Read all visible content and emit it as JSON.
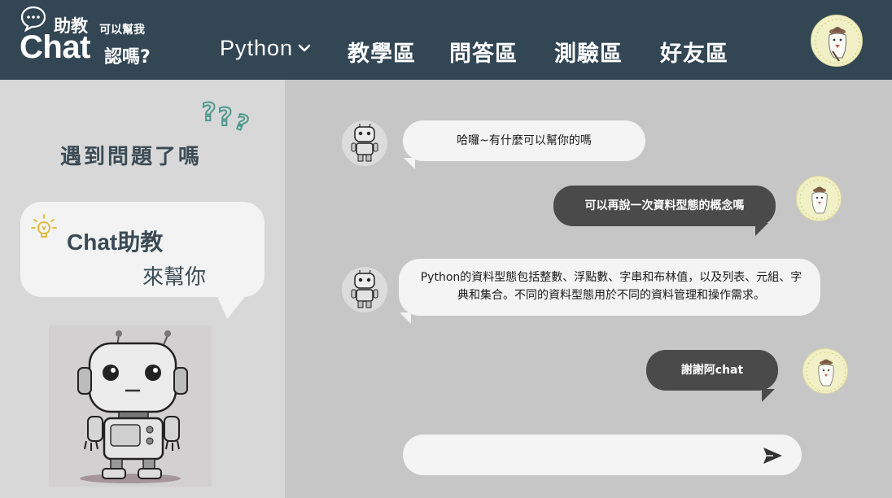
{
  "app": {
    "logo_line1": "助教",
    "logo_line2": "可以幫我",
    "logo_line3": "Chat",
    "logo_line4": "認嗎?"
  },
  "nav": {
    "items": [
      {
        "label": "Python"
      },
      {
        "label": "教學區"
      },
      {
        "label": "問答區"
      },
      {
        "label": "測驗區"
      },
      {
        "label": "好友區"
      }
    ]
  },
  "sidebar": {
    "title": "遇到問題了嗎",
    "speech_line1": "Chat助教",
    "speech_line2": "來幫你"
  },
  "chat": {
    "messages": [
      {
        "from": "bot",
        "text": "哈囉~有什麼可以幫你的嗎"
      },
      {
        "from": "user",
        "text": "可以再說一次資料型態的概念嗎"
      },
      {
        "from": "bot",
        "text": "Python的資料型態包括整數、浮點數、字串和布林值，以及列表、元組、字典和集合。不同的資料型態用於不同的資料管理和操作需求。"
      },
      {
        "from": "user",
        "text": "謝謝阿chat"
      }
    ],
    "input_placeholder": ""
  },
  "colors": {
    "header_bg": "#324654",
    "left_panel_bg": "#d8d8d8",
    "chat_bg": "#c6c6c6",
    "bot_bubble": "#f4f4f4",
    "user_bubble": "#4a4a4a"
  },
  "icons": {
    "logo": "chat-bubble-icon",
    "dropdown": "chevron-down-icon",
    "decor": "question-marks-icon",
    "bulb": "lightbulb-icon",
    "send": "send-icon"
  }
}
